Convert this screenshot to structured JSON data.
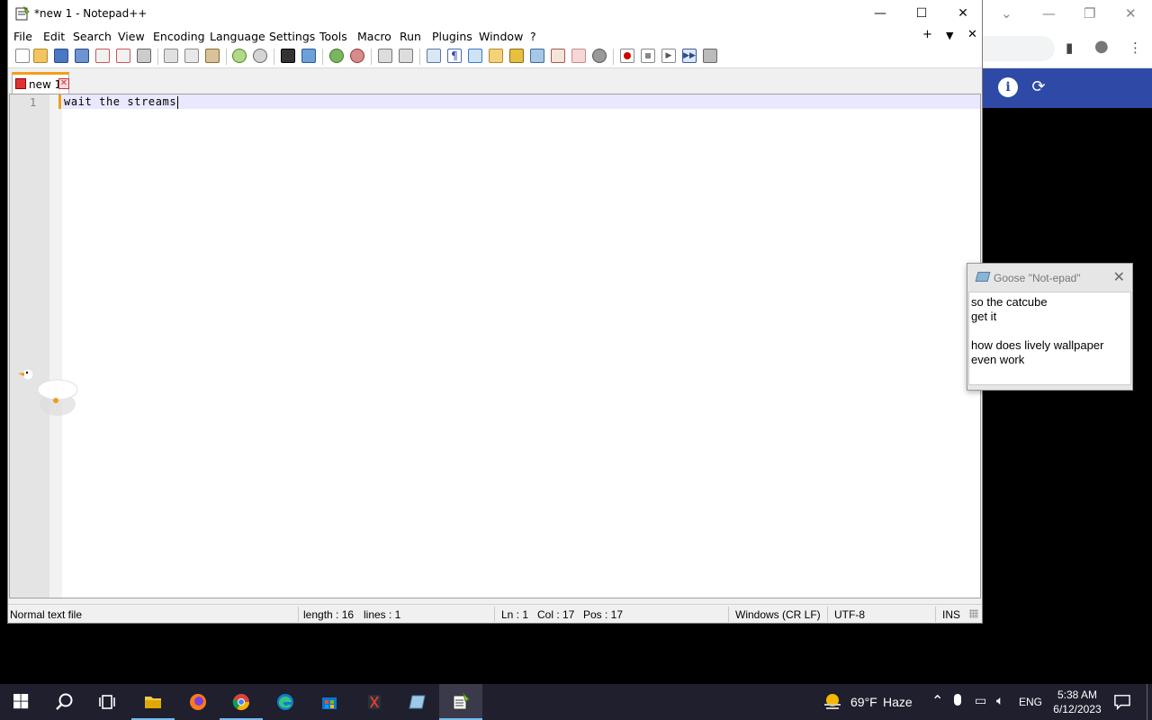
{
  "notepad": {
    "window_title": "*new 1 - Notepad++",
    "menu": [
      "File",
      "Edit",
      "Search",
      "View",
      "Encoding",
      "Language",
      "Settings",
      "Tools",
      "Macro",
      "Run",
      "Plugins",
      "Window",
      "?"
    ],
    "menu_right": {
      "add": "+",
      "dropdown": "▼",
      "close": "✕"
    },
    "window_buttons": {
      "minimize": "—",
      "maximize": "☐",
      "close": "✕"
    },
    "tab": {
      "label": "new 1",
      "close": "✕"
    },
    "editor": {
      "line_number": "1",
      "text": "wait the streams"
    },
    "status": {
      "file_type": "Normal text file",
      "length": "length : 16",
      "lines": "lines : 1",
      "ln": "Ln : 1",
      "col": "Col : 17",
      "pos": "Pos : 17",
      "eol": "Windows (CR LF)",
      "encoding": "UTF-8",
      "mode": "INS"
    }
  },
  "goose_note": {
    "title": "Goose \"Not-epad\"",
    "body": "so the catcube\nget it\n\nhow does lively wallpaper even work"
  },
  "taskbar": {
    "weather": {
      "temp": "69°F",
      "condition": "Haze"
    },
    "language": "ENG",
    "time": "5:38 AM",
    "date": "6/12/2023"
  },
  "colors": {
    "accent_orange": "#f59c1a",
    "browser_blue": "#2e4aa6",
    "taskbar_bg": "#1f1f2e"
  }
}
